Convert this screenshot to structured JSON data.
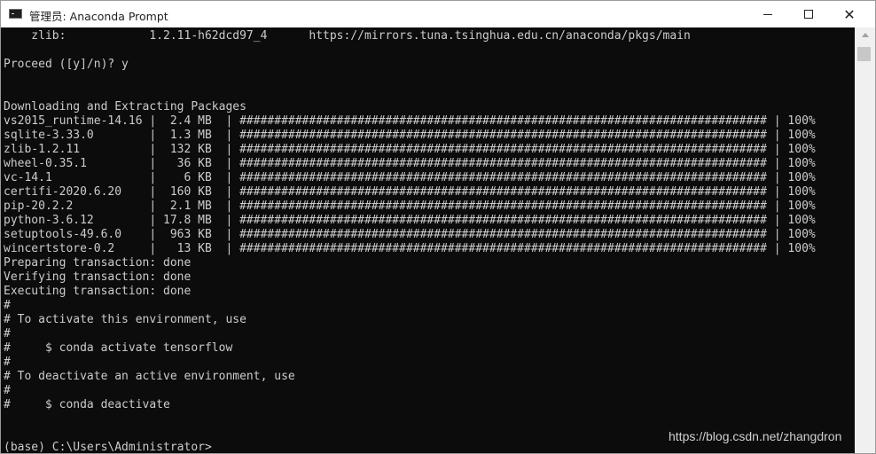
{
  "window": {
    "title": "管理员: Anaconda Prompt",
    "controls": {
      "minimize": "─",
      "maximize": "☐",
      "close": "✕"
    },
    "icon": "console-window-icon"
  },
  "console": {
    "lines": [
      "    zlib:            1.2.11-h62dcd97_4      https://mirrors.tuna.tsinghua.edu.cn/anaconda/pkgs/main",
      "",
      "Proceed ([y]/n)? y",
      "",
      "",
      "Downloading and Extracting Packages",
      "vs2015_runtime-14.16 |  2.4 MB  | ############################################################################ | 100%",
      "sqlite-3.33.0        |  1.3 MB  | ############################################################################ | 100%",
      "zlib-1.2.11          |  132 KB  | ############################################################################ | 100%",
      "wheel-0.35.1         |   36 KB  | ############################################################################ | 100%",
      "vc-14.1              |    6 KB  | ############################################################################ | 100%",
      "certifi-2020.6.20    |  160 KB  | ############################################################################ | 100%",
      "pip-20.2.2           |  2.1 MB  | ############################################################################ | 100%",
      "python-3.6.12        | 17.8 MB  | ############################################################################ | 100%",
      "setuptools-49.6.0    |  963 KB  | ############################################################################ | 100%",
      "wincertstore-0.2     |   13 KB  | ############################################################################ | 100%",
      "Preparing transaction: done",
      "Verifying transaction: done",
      "Executing transaction: done",
      "#",
      "# To activate this environment, use",
      "#",
      "#     $ conda activate tensorflow",
      "#",
      "# To deactivate an active environment, use",
      "#",
      "#     $ conda deactivate",
      "",
      "",
      "(base) C:\\Users\\Administrator>"
    ]
  },
  "watermark": "https://blog.csdn.net/zhangdron"
}
